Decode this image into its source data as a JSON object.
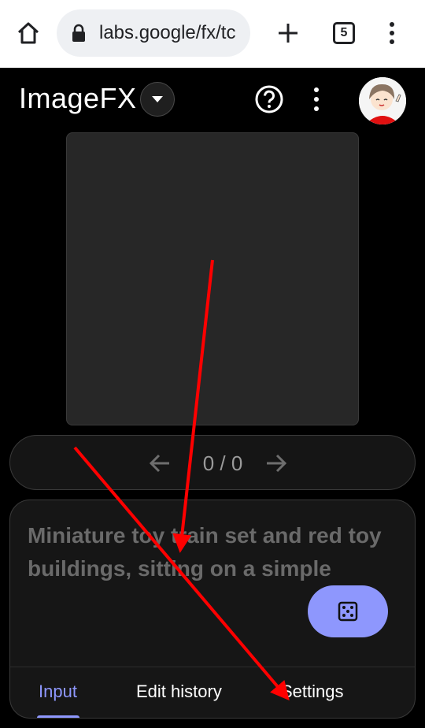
{
  "browser": {
    "url": "labs.google/fx/tc",
    "tab_count": "5"
  },
  "app": {
    "title": "ImageFX"
  },
  "pager": {
    "count": "0 / 0"
  },
  "prompt": {
    "placeholder": "Miniature toy train set and red toy buildings, sitting on a simple"
  },
  "tabs": [
    {
      "label": "Input",
      "active": true
    },
    {
      "label": "Edit history",
      "active": false
    },
    {
      "label": "Settings",
      "active": false
    }
  ],
  "colors": {
    "accent": "#8e97fd",
    "annotation": "#ff0000"
  },
  "icons": [
    "home-icon",
    "lock-icon",
    "plus-icon",
    "tab-switcher-icon",
    "more-vert-icon",
    "chevron-down-icon",
    "help-icon",
    "arrow-left-icon",
    "arrow-right-icon",
    "dice-icon"
  ]
}
